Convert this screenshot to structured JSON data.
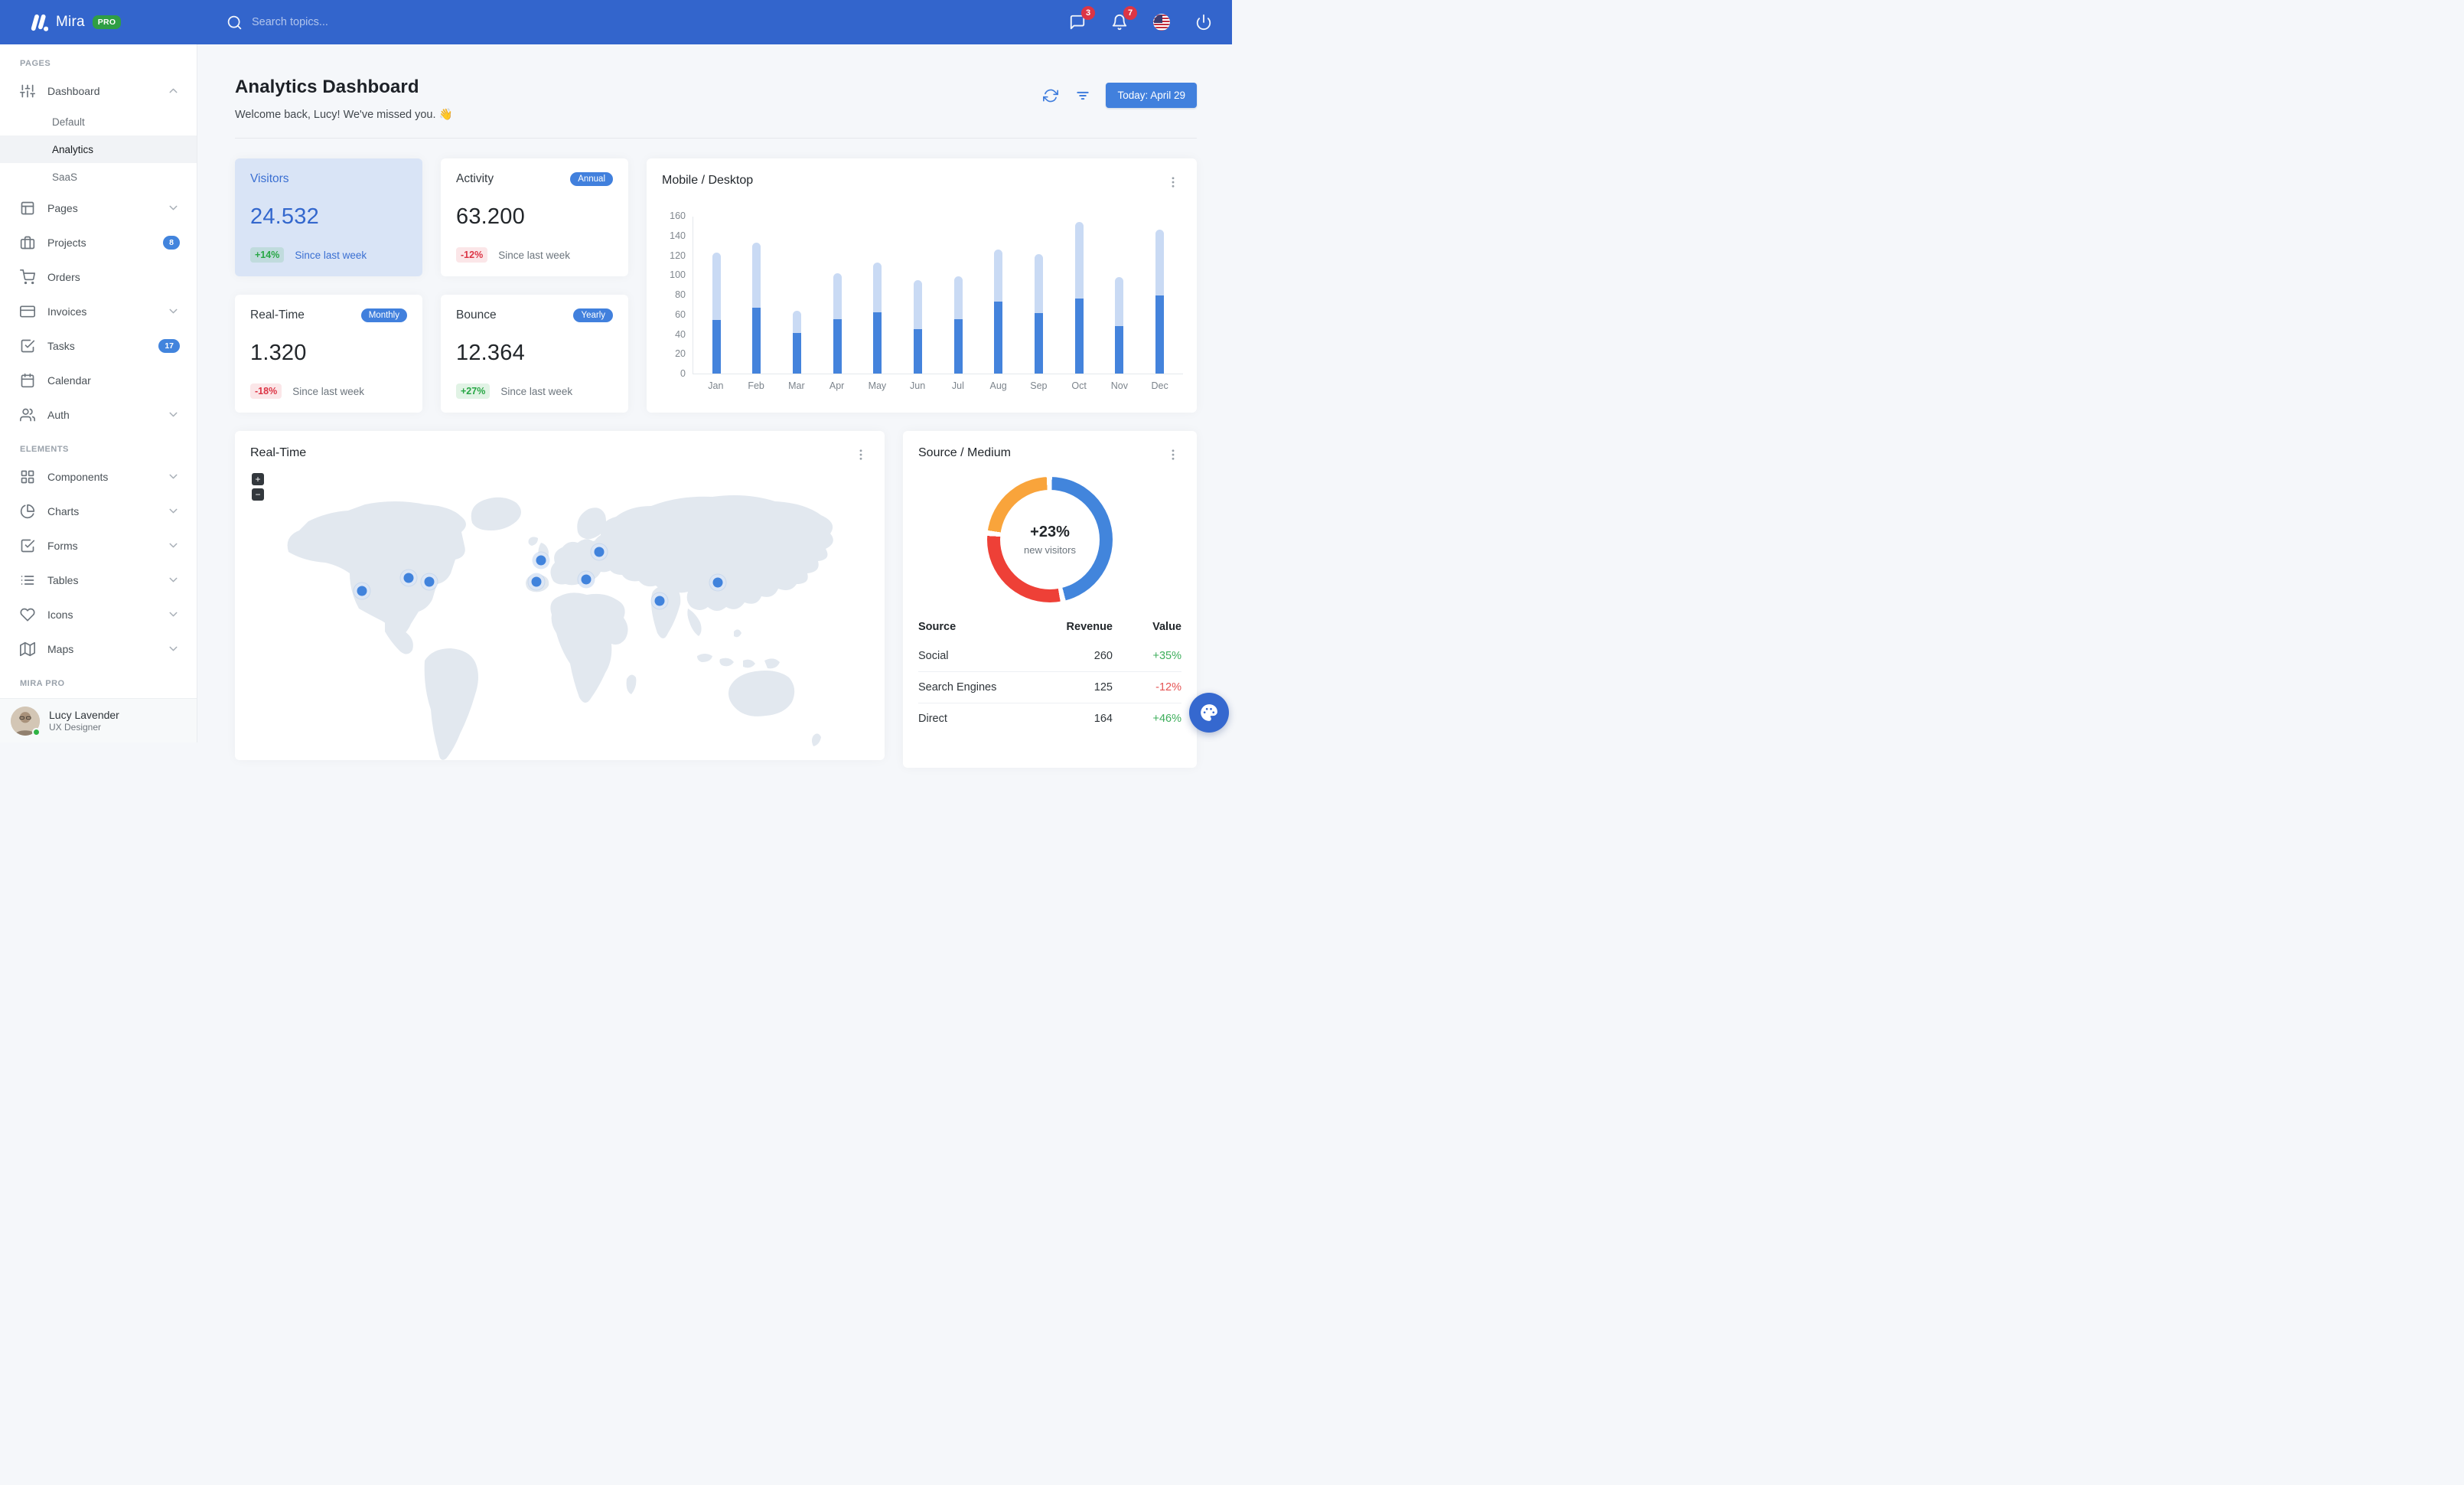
{
  "navbar": {
    "brand": "Mira",
    "brand_badge": "PRO",
    "search_placeholder": "Search topics...",
    "messages_badge": "3",
    "notifications_badge": "7"
  },
  "sidebar": {
    "sections": [
      {
        "label": "PAGES",
        "items": [
          {
            "icon": "sliders",
            "label": "Dashboard",
            "chevron": "up",
            "children": [
              {
                "label": "Default",
                "active": false
              },
              {
                "label": "Analytics",
                "active": true
              },
              {
                "label": "SaaS",
                "active": false
              }
            ]
          },
          {
            "icon": "layout",
            "label": "Pages",
            "chevron": "down"
          },
          {
            "icon": "briefcase",
            "label": "Projects",
            "badge": "8"
          },
          {
            "icon": "shopping-cart",
            "label": "Orders"
          },
          {
            "icon": "credit-card",
            "label": "Invoices",
            "chevron": "down"
          },
          {
            "icon": "check-square",
            "label": "Tasks",
            "badge": "17"
          },
          {
            "icon": "calendar",
            "label": "Calendar"
          },
          {
            "icon": "users",
            "label": "Auth",
            "chevron": "down"
          }
        ]
      },
      {
        "label": "ELEMENTS",
        "items": [
          {
            "icon": "grid",
            "label": "Components",
            "chevron": "down"
          },
          {
            "icon": "pie-chart",
            "label": "Charts",
            "chevron": "down"
          },
          {
            "icon": "check-square",
            "label": "Forms",
            "chevron": "down"
          },
          {
            "icon": "list",
            "label": "Tables",
            "chevron": "down"
          },
          {
            "icon": "heart",
            "label": "Icons",
            "chevron": "down"
          },
          {
            "icon": "map",
            "label": "Maps",
            "chevron": "down"
          }
        ]
      },
      {
        "label": "MIRA PRO",
        "items": []
      }
    ],
    "user": {
      "name": "Lucy Lavender",
      "role": "UX Designer"
    }
  },
  "header": {
    "title": "Analytics Dashboard",
    "subtitle": "Welcome back, Lucy! We've missed you. 👋",
    "date_button": "Today: April 29"
  },
  "stats": [
    {
      "title": "Visitors",
      "badge": "",
      "value": "24.532",
      "delta": "+14%",
      "delta_type": "positive",
      "caption": "Since last week",
      "variant": "primary"
    },
    {
      "title": "Activity",
      "badge": "Annual",
      "value": "63.200",
      "delta": "-12%",
      "delta_type": "negative",
      "caption": "Since last week",
      "variant": "default"
    },
    {
      "title": "Real-Time",
      "badge": "Monthly",
      "value": "1.320",
      "delta": "-18%",
      "delta_type": "negative",
      "caption": "Since last week",
      "variant": "default"
    },
    {
      "title": "Bounce",
      "badge": "Yearly",
      "value": "12.364",
      "delta": "+27%",
      "delta_type": "positive",
      "caption": "Since last week",
      "variant": "default"
    }
  ],
  "chart_data": [
    {
      "type": "bar",
      "title": "Mobile / Desktop",
      "stacked": true,
      "categories": [
        "Jan",
        "Feb",
        "Mar",
        "Apr",
        "May",
        "Jun",
        "Jul",
        "Aug",
        "Sep",
        "Oct",
        "Nov",
        "Dec"
      ],
      "series": [
        {
          "name": "Mobile",
          "color": "#4483dc",
          "values": [
            54,
            67,
            41,
            55,
            62,
            45,
            55,
            73,
            61,
            76,
            48,
            79
          ]
        },
        {
          "name": "Desktop",
          "color": "#c9daf4",
          "values": [
            69,
            66,
            23,
            47,
            51,
            50,
            44,
            53,
            60,
            78,
            50,
            67
          ]
        }
      ],
      "ylim": [
        0,
        160
      ],
      "yticks": [
        0,
        20,
        40,
        60,
        80,
        100,
        120,
        140,
        160
      ],
      "grid": false,
      "legend": "none"
    },
    {
      "type": "pie",
      "title": "Source / Medium",
      "labels": [
        "Social",
        "Direct",
        "Search Engines"
      ],
      "values": [
        260,
        164,
        125
      ],
      "colors": [
        "#4285dc",
        "#ee4037",
        "#f9a43b"
      ],
      "center_text": "+23%",
      "center_subtext": "new visitors",
      "donut": true
    }
  ],
  "map": {
    "title": "Real-Time",
    "zoom_in": "+",
    "zoom_out": "−",
    "markers": [
      {
        "x": 166,
        "y": 209
      },
      {
        "x": 227,
        "y": 192
      },
      {
        "x": 254,
        "y": 197
      },
      {
        "x": 400,
        "y": 169
      },
      {
        "x": 394,
        "y": 197
      },
      {
        "x": 459,
        "y": 194
      },
      {
        "x": 476,
        "y": 158
      },
      {
        "x": 555,
        "y": 222
      },
      {
        "x": 631,
        "y": 198
      }
    ]
  },
  "source_medium": {
    "title": "Source / Medium",
    "center_value": "+23%",
    "center_label": "new visitors",
    "table": {
      "headers": [
        "Source",
        "Revenue",
        "Value"
      ],
      "rows": [
        {
          "source": "Social",
          "revenue": "260",
          "value": "+35%"
        },
        {
          "source": "Search Engines",
          "revenue": "125",
          "value": "-12%"
        },
        {
          "source": "Direct",
          "revenue": "164",
          "value": "+46%"
        }
      ]
    }
  },
  "colors": {
    "navbar": "#3365cc",
    "primary": "#4180dd",
    "success": "#28a745",
    "danger": "#dc3545",
    "bar_mobile": "#4483dc",
    "bar_desktop": "#c9daf4",
    "donut": [
      "#4285dc",
      "#ee4037",
      "#f9a43b"
    ]
  }
}
